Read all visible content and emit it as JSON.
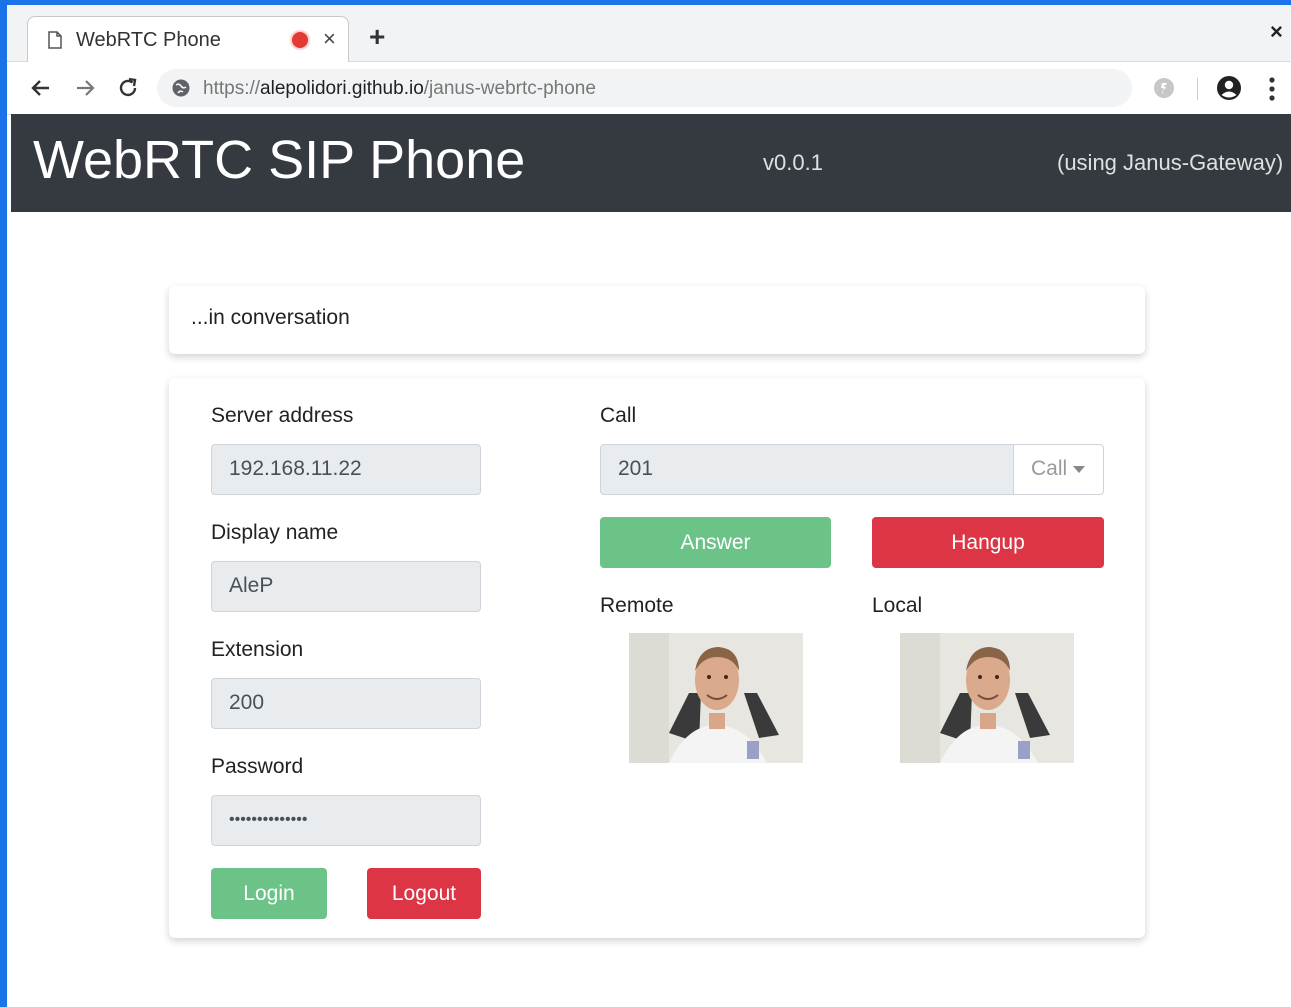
{
  "browser": {
    "tab_title": "WebRTC Phone",
    "tab_close": "×",
    "new_tab": "+",
    "window_close": "×",
    "url_scheme": "https://",
    "url_host": "alepolidori.github.io",
    "url_path": "/janus-webrtc-phone",
    "icons": [
      "page-icon",
      "recording-indicator-icon",
      "back-arrow-icon",
      "forward-arrow-icon",
      "reload-icon",
      "globe-icon",
      "extension-icon",
      "account-icon",
      "menu-dots-icon"
    ]
  },
  "navbar": {
    "brand": "WebRTC SIP Phone",
    "version": "v0.0.1",
    "using": "(using Janus-Gateway)"
  },
  "status": {
    "text": "...in conversation"
  },
  "login": {
    "server_label": "Server address",
    "server_value": "192.168.11.22",
    "display_label": "Display name",
    "display_value": "AleP",
    "extension_label": "Extension",
    "extension_value": "200",
    "password_label": "Password",
    "password_value": "••••••••••••••",
    "login_button": "Login",
    "logout_button": "Logout"
  },
  "call": {
    "label": "Call",
    "value": "201",
    "dropdown": "Call",
    "answer_button": "Answer",
    "hangup_button": "Hangup",
    "remote_label": "Remote",
    "local_label": "Local"
  },
  "colors": {
    "navbar": "#343a40",
    "green": "#6cc388",
    "red": "#dc3545",
    "frame": "#1a73e8"
  }
}
